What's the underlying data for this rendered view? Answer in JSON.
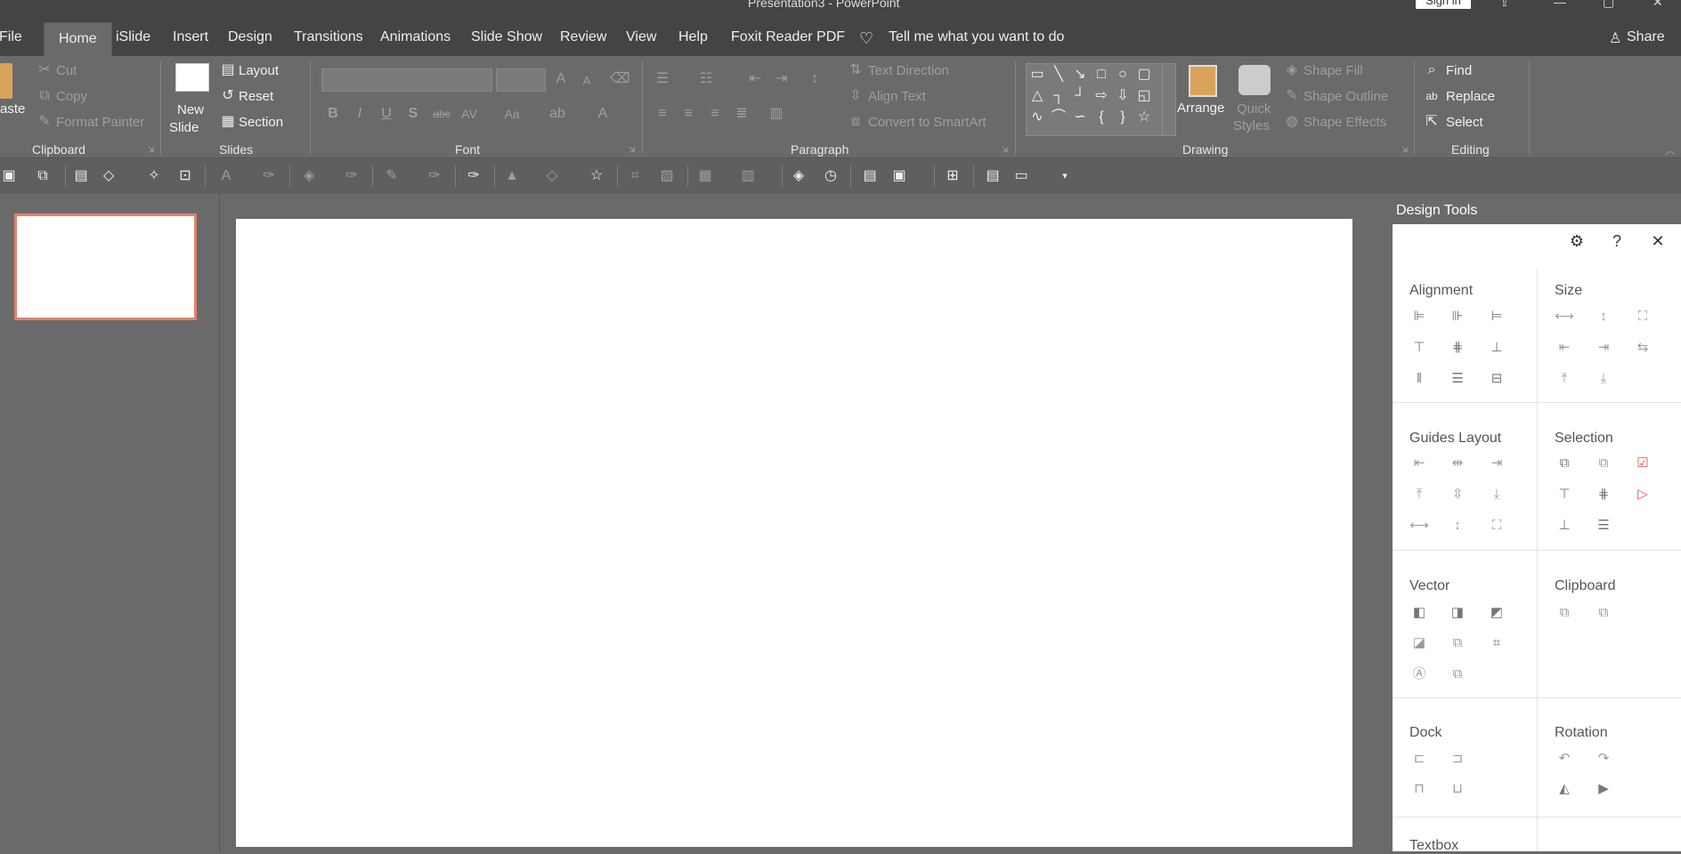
{
  "window": {
    "title": "Presentation3 - PowerPoint",
    "signin": "Sign in"
  },
  "tabs": [
    "File",
    "Home",
    "iSlide",
    "Insert",
    "Design",
    "Transitions",
    "Animations",
    "Slide Show",
    "Review",
    "View",
    "Help",
    "Foxit Reader PDF"
  ],
  "tell_me": "Tell me what you want to do",
  "share": "Share",
  "clipboard": {
    "paste": "aste",
    "cut": "Cut",
    "copy": "Copy",
    "format_painter": "Format Painter",
    "label": "Clipboard"
  },
  "slides": {
    "new_slide_1": "New",
    "new_slide_2": "Slide",
    "layout": "Layout",
    "reset": "Reset",
    "section": "Section",
    "label": "Slides"
  },
  "font": {
    "label": "Font",
    "bold": "B",
    "italic": "I",
    "underline": "U",
    "shadow": "S",
    "strike": "abc",
    "spacing": "AV",
    "case": "Aa",
    "color": "A"
  },
  "paragraph": {
    "label": "Paragraph",
    "text_direction": "Text Direction",
    "align_text": "Align Text",
    "convert_smartart": "Convert to SmartArt"
  },
  "drawing": {
    "label": "Drawing",
    "arrange": "Arrange",
    "quick_styles_1": "Quick",
    "quick_styles_2": "Styles",
    "shape_fill": "Shape Fill",
    "shape_outline": "Shape Outline",
    "shape_effects": "Shape Effects"
  },
  "editing": {
    "label": "Editing",
    "find": "Find",
    "replace": "Replace",
    "select": "Select"
  },
  "design_tools": {
    "title": "Design Tools",
    "sections": {
      "alignment": "Alignment",
      "size": "Size",
      "guides_layout": "Guides Layout",
      "selection": "Selection",
      "vector": "Vector",
      "clipboard": "Clipboard",
      "dock": "Dock",
      "rotation": "Rotation",
      "textbox": "Textbox"
    }
  }
}
